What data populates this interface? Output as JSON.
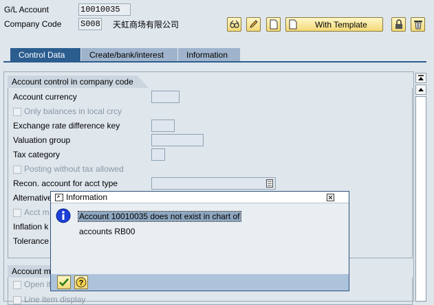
{
  "header": {
    "gl_account_label": "G/L Account",
    "gl_account_value": "10010035",
    "company_code_label": "Company Code",
    "company_code_value": "S008",
    "company_name": "天虹商场有限公司"
  },
  "toolbar": {
    "with_template_label": "With Template",
    "buttons": [
      "glasses-icon",
      "pencil-icon",
      "new-document-icon",
      "template-document-icon",
      "lock-icon",
      "trash-icon"
    ]
  },
  "tabs": [
    {
      "label": "Control Data",
      "active": true
    },
    {
      "label": "Create/bank/interest",
      "active": false
    },
    {
      "label": "Information",
      "active": false
    }
  ],
  "account_control": {
    "title": "Account control in company code",
    "account_currency": "Account currency",
    "only_balances": "Only balances in local crcy",
    "exchange_rate_key": "Exchange rate difference key",
    "valuation_group": "Valuation group",
    "tax_category": "Tax category",
    "posting_without_tax": "Posting without tax allowed",
    "recon_account": "Recon. account for acct type",
    "alternative_partial": "Alternative",
    "acct_partial": "Acct m",
    "inflation_partial": "Inflation k",
    "tolerance_partial": "Tolerance"
  },
  "account_management": {
    "title_partial": "Account m",
    "open_item_partial": "Open it",
    "line_item_partial": "Line item display"
  },
  "dialog": {
    "title": "Information",
    "message_line1": "Account 10010035 does not exist in chart of",
    "message_line2": "accounts RB00",
    "ok_icon": "checkmark-icon",
    "help_icon": "help-icon"
  },
  "colors": {
    "tab_active": "#2b5d8f",
    "tab_inactive": "#9fb4cc",
    "dialog_footer": "#adc3dc",
    "info_icon": "#1c3fd8"
  }
}
